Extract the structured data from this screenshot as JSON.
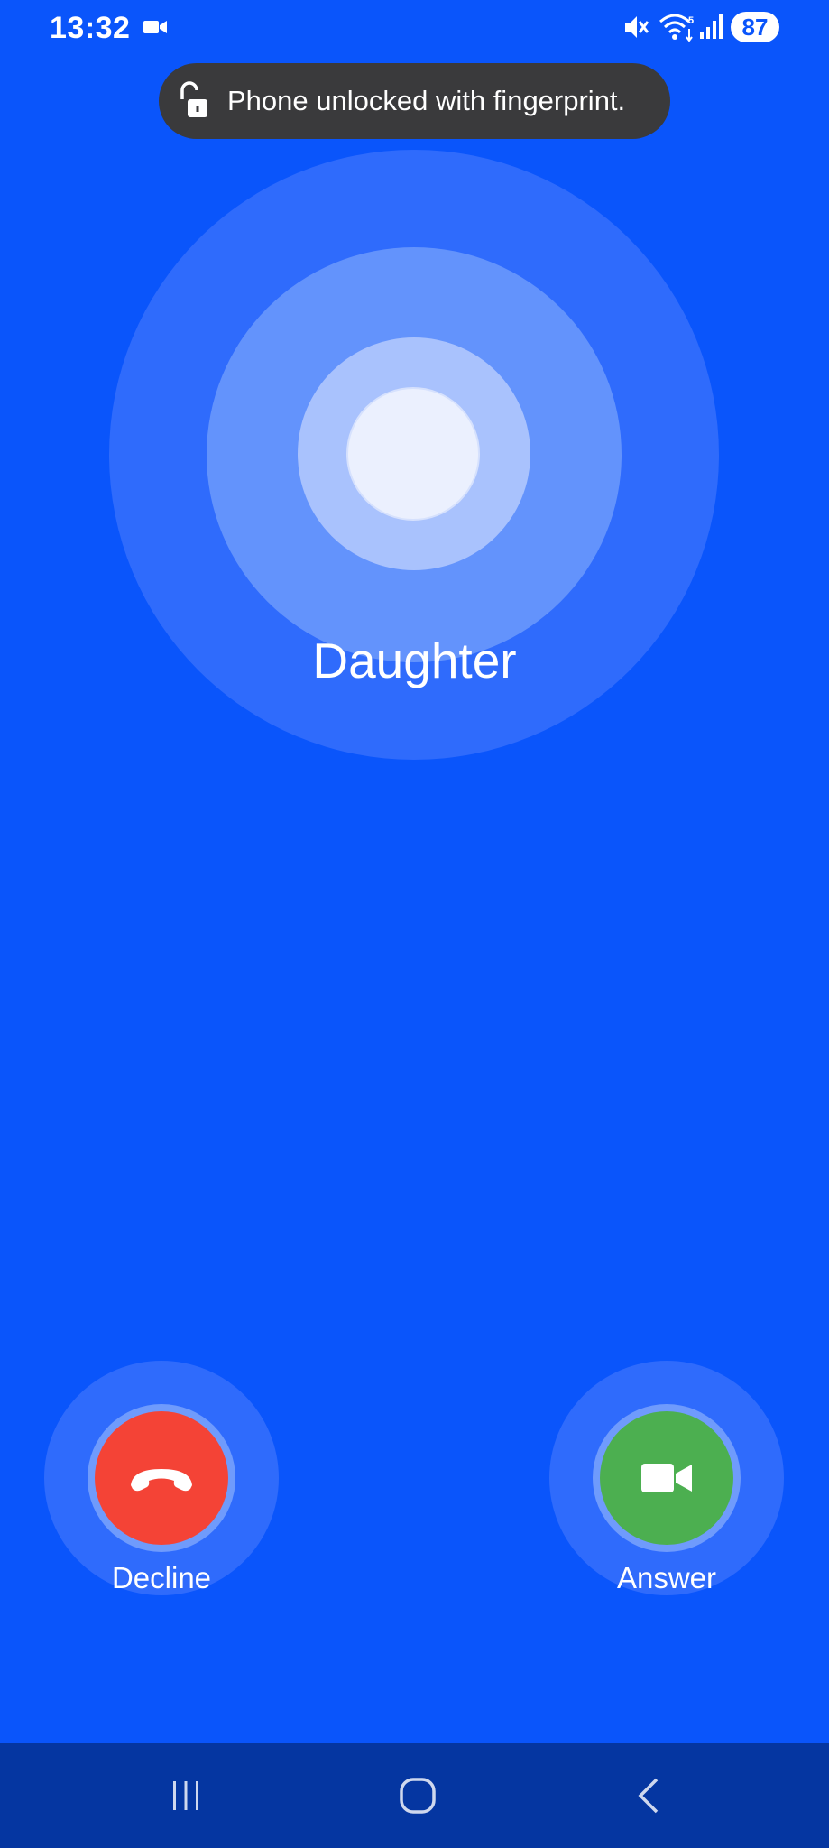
{
  "status_bar": {
    "time": "13:32",
    "battery": "87",
    "icons": [
      "video-camera-icon",
      "mute-icon",
      "wifi-icon",
      "signal-icon"
    ]
  },
  "toast": {
    "icon": "unlock-icon",
    "text": "Phone unlocked with fingerprint."
  },
  "call": {
    "caller_name": "Daughter",
    "avatar_icon": "avatar-placeholder"
  },
  "actions": {
    "decline": {
      "label": "Decline",
      "icon": "phone-hangup-icon",
      "color": "#f44336"
    },
    "answer": {
      "label": "Answer",
      "icon": "video-camera-icon",
      "color": "#4caf50"
    }
  },
  "nav_bar": {
    "buttons": [
      "recents-icon",
      "home-icon",
      "back-icon"
    ]
  },
  "colors": {
    "background": "#0a55fb",
    "nav_background": "#0536a1",
    "toast_background": "#3a3a3c"
  }
}
